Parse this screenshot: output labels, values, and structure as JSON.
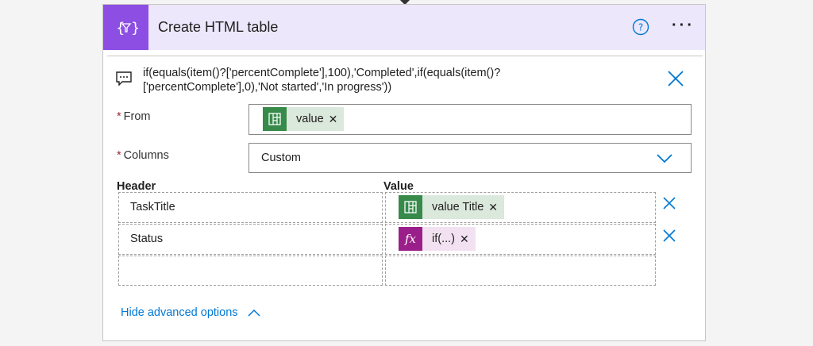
{
  "action": {
    "title": "Create HTML table",
    "comment": "if(equals(item()?['percentComplete'],100),'Completed',if(equals(item()?['percentComplete'],0),'Not started','In progress'))",
    "comment_line1": "if(equals(item()?['percentComplete'],100),'Completed',if(equals(item()?",
    "comment_line2": "['percentComplete'],0),'Not started','In progress'))"
  },
  "fields": {
    "from": {
      "label": "From",
      "required_mark": "*",
      "token": {
        "label": "value",
        "type": "dynamic",
        "icon": "table-icon"
      }
    },
    "columns": {
      "label": "Columns",
      "required_mark": "*",
      "value": "Custom"
    }
  },
  "table": {
    "header_label": "Header",
    "value_label": "Value",
    "rows": [
      {
        "header": "TaskTitle",
        "value_token": {
          "label": "value Title",
          "type": "dynamic",
          "icon": "table-icon"
        }
      },
      {
        "header": "Status",
        "value_token": {
          "label": "if(...)",
          "type": "expression",
          "icon": "fx-icon"
        }
      },
      {
        "header": "",
        "value_token": null
      }
    ]
  },
  "advanced": {
    "label": "Hide advanced options"
  },
  "colors": {
    "accent": "#8c4ee3",
    "link": "#0078d4",
    "dynamic": "#378a4a",
    "expression": "#9b1f8a"
  }
}
